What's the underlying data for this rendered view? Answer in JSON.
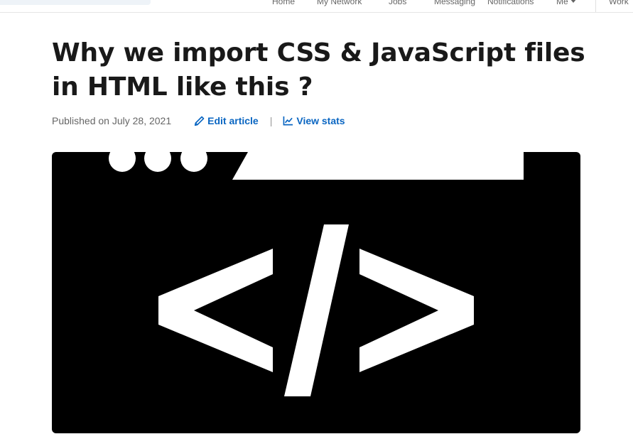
{
  "nav": {
    "items": [
      "Home",
      "My Network",
      "Jobs",
      "Messaging",
      "Notifications",
      "Me",
      "Work"
    ]
  },
  "article": {
    "title": "Why we import CSS & JavaScript files in HTML like this ?",
    "published": "Published on July 28, 2021",
    "edit_label": "Edit article",
    "separator": "|",
    "stats_label": "View stats"
  },
  "hero": {
    "icon": "code-brackets-icon",
    "background": "#000000",
    "foreground": "#ffffff"
  },
  "colors": {
    "accent": "#0a66c2",
    "title": "#191919",
    "muted": "#666666"
  }
}
